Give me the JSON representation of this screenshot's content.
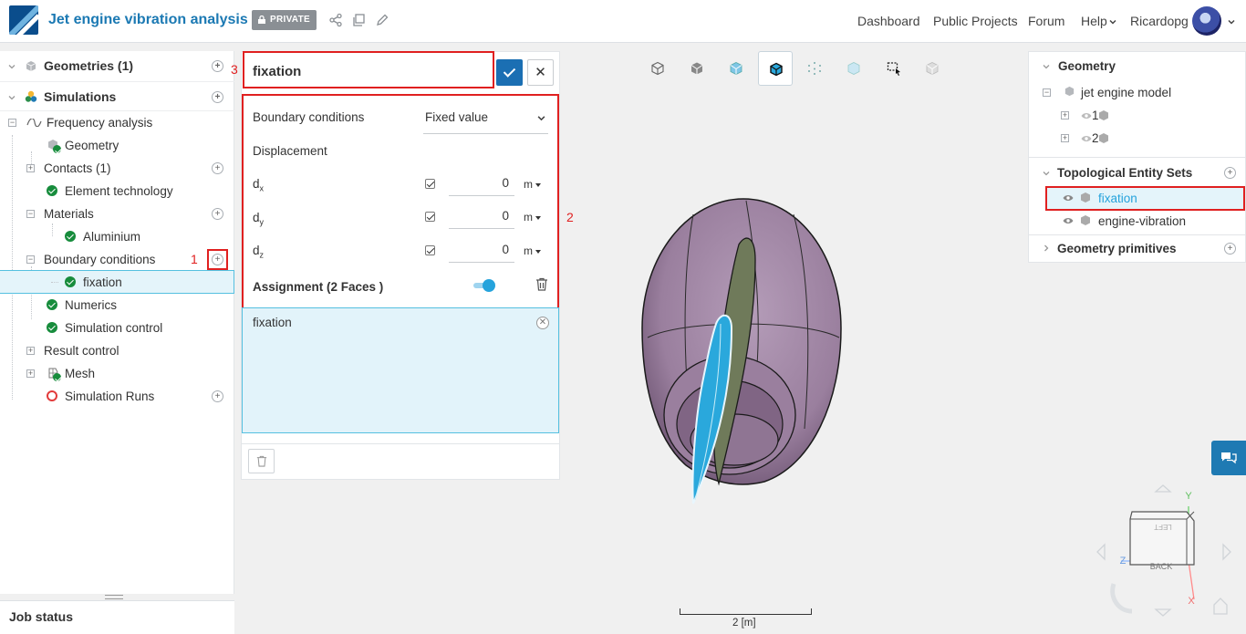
{
  "header": {
    "title": "Jet engine vibration analysis",
    "private_label": "PRIVATE",
    "nav": [
      "Dashboard",
      "Public Projects",
      "Forum",
      "Help"
    ],
    "username": "Ricardopg"
  },
  "sidebar": {
    "geometries": "Geometries (1)",
    "simulations": "Simulations",
    "frequency_analysis": "Frequency analysis",
    "geometry": "Geometry",
    "contacts": "Contacts (1)",
    "element_technology": "Element technology",
    "materials": "Materials",
    "aluminium": "Aluminium",
    "boundary_conditions": "Boundary conditions",
    "fixation": "fixation",
    "numerics": "Numerics",
    "simulation_control": "Simulation control",
    "result_control": "Result control",
    "mesh": "Mesh",
    "simulation_runs": "Simulation Runs",
    "job_status": "Job status"
  },
  "annotations": {
    "one": "1",
    "two": "2",
    "three": "3"
  },
  "editor": {
    "name": "fixation",
    "boundary_conditions_label": "Boundary conditions",
    "boundary_conditions_value": "Fixed value",
    "displacement_label": "Displacement",
    "dx": {
      "base": "d",
      "sub": "x",
      "value": "0",
      "unit": "m"
    },
    "dy": {
      "base": "d",
      "sub": "y",
      "value": "0",
      "unit": "m"
    },
    "dz": {
      "base": "d",
      "sub": "z",
      "value": "0",
      "unit": "m"
    },
    "assignment_label": "Assignment (2 Faces )",
    "assigned_item": "fixation"
  },
  "right_panel": {
    "geometry": "Geometry",
    "model": "jet engine model",
    "part1": "1",
    "part2": "2",
    "topological_sets": "Topological Entity Sets",
    "set_fixation": "fixation",
    "set_engine_vibration": "engine-vibration",
    "geometry_primitives": "Geometry primitives"
  },
  "viewer": {
    "scale_label": "2 [m]",
    "cube_back": "BACK",
    "cube_left": "LEFT",
    "axis_y": "Y",
    "axis_z": "Z",
    "axis_x": "X"
  },
  "colors": {
    "accent": "#1b79b3",
    "annotation_red": "#e02020",
    "ok_green": "#178c3c",
    "engine_body": "#9a7f9e",
    "blade": "#2aa8dc"
  }
}
